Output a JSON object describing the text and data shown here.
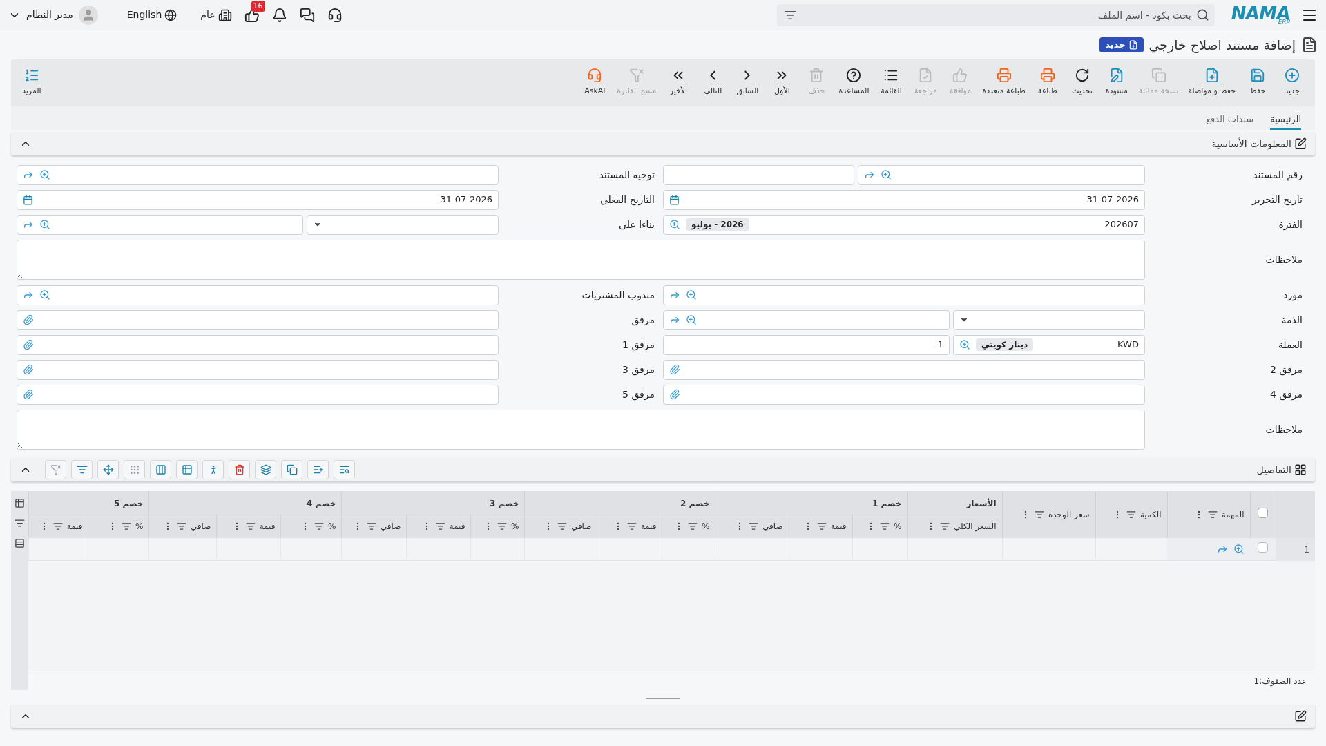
{
  "topbar": {
    "logo": "NAMA",
    "logo_sub": "ERP",
    "search": {
      "placeholder": "بحث بكود - اسم الملف"
    },
    "notifications_badge": "16",
    "branch": "عام",
    "language": "English",
    "user": "مدير النظام"
  },
  "title": "إضافة مستند اصلاح خارجي",
  "status_badge": "جديد",
  "toolbar": {
    "items": [
      {
        "label": "جديد",
        "disabled": false
      },
      {
        "label": "حفظ",
        "disabled": false
      },
      {
        "label": "حفظ و مواصلة",
        "disabled": false
      },
      {
        "label": "نسخة مماثلة",
        "disabled": true
      },
      {
        "label": "مسودة",
        "disabled": false
      },
      {
        "label": "تحديث",
        "disabled": false
      },
      {
        "label": "طباعة",
        "disabled": false
      },
      {
        "label": "طباعة متعددة",
        "disabled": false
      },
      {
        "label": "موافقة",
        "disabled": true
      },
      {
        "label": "مراجعة",
        "disabled": true
      },
      {
        "label": "القائمة",
        "disabled": false
      },
      {
        "label": "المساعدة",
        "disabled": false
      },
      {
        "label": "حذف",
        "disabled": true
      },
      {
        "label": "الأول",
        "disabled": false
      },
      {
        "label": "السابق",
        "disabled": false
      },
      {
        "label": "التالي",
        "disabled": false
      },
      {
        "label": "الأخير",
        "disabled": false
      },
      {
        "label": "مسح الفلترة",
        "disabled": true
      },
      {
        "label": "AskAI",
        "disabled": false
      }
    ],
    "more": "المزيد"
  },
  "tabs": [
    {
      "label": "الرئيسية",
      "selected": true
    },
    {
      "label": "سندات الدفع",
      "selected": false
    }
  ],
  "basic_section": {
    "title": "المعلومات الأساسية",
    "expanded": true,
    "rows": [
      {
        "cells": [
          {
            "label": "رقم المستند",
            "kind": "doc_number"
          },
          {
            "label": "توجيه المستند",
            "kind": "lookup"
          }
        ]
      },
      {
        "cells": [
          {
            "label": "تاريخ التحرير",
            "kind": "date",
            "value": "31-07-2026"
          },
          {
            "label": "التاريخ الفعلي",
            "kind": "date",
            "value": "31-07-2026"
          }
        ]
      },
      {
        "cells": [
          {
            "label": "الفترة",
            "kind": "period",
            "value": "202607",
            "chip": "2026 - يوليو"
          },
          {
            "label": "بناءا على",
            "kind": "select_lookup"
          }
        ]
      },
      {
        "cells": [
          {
            "label": "ملاحظات",
            "kind": "textarea"
          }
        ]
      },
      {
        "cells": [
          {
            "label": "مورد",
            "kind": "lookup"
          },
          {
            "label": "مندوب المشتريات",
            "kind": "lookup"
          }
        ]
      },
      {
        "cells": [
          {
            "label": "الذمة",
            "kind": "select_lookup"
          },
          {
            "label": "مرفق",
            "kind": "attachment"
          }
        ]
      },
      {
        "cells": [
          {
            "label": "العملة",
            "kind": "currency",
            "value": "KWD",
            "chip": "دينار كويتي",
            "rate": "1"
          },
          {
            "label": "مرفق 1",
            "kind": "attachment"
          }
        ]
      },
      {
        "cells": [
          {
            "label": "مرفق 2",
            "kind": "attachment"
          },
          {
            "label": "مرفق 3",
            "kind": "attachment"
          }
        ]
      },
      {
        "cells": [
          {
            "label": "مرفق 4",
            "kind": "attachment"
          },
          {
            "label": "مرفق 5",
            "kind": "attachment"
          }
        ]
      },
      {
        "cells": [
          {
            "label": "ملاحظات",
            "kind": "textarea"
          }
        ]
      }
    ]
  },
  "details": {
    "title": "التفاصيل",
    "expanded": true,
    "table": {
      "header_checked": false,
      "single_columns": [
        "المهمة",
        "الكمية",
        "سعر الوحدة"
      ],
      "groups": [
        {
          "label": "الأسعار",
          "columns": [
            "السعر الكلي"
          ]
        },
        {
          "label": "خصم 1",
          "columns": [
            "%",
            "قيمة",
            "صافي"
          ]
        },
        {
          "label": "خصم 2",
          "columns": [
            "%",
            "قيمة",
            "صافي"
          ]
        },
        {
          "label": "خصم 3",
          "columns": [
            "%",
            "قيمة",
            "صافي"
          ]
        },
        {
          "label": "خصم 4",
          "columns": [
            "%",
            "قيمة",
            "صافي"
          ]
        },
        {
          "label": "خصم 5",
          "columns": [
            "%",
            "قيمة"
          ]
        }
      ],
      "rows": [
        {
          "number": "1",
          "checked": false
        }
      ]
    },
    "row_count": "عدد الصفوف:1"
  },
  "bottom_section": {
    "expanded": true
  }
}
